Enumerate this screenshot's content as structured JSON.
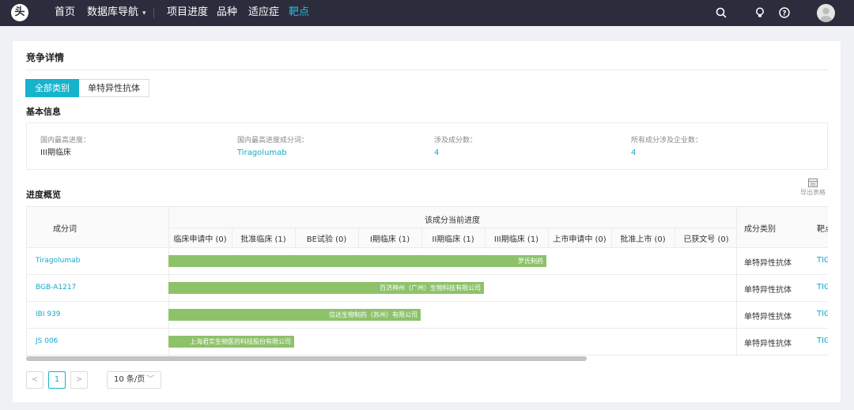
{
  "nav": {
    "logo_text": "头",
    "items": [
      "首页",
      "数据库导航",
      "项目进度",
      "品种",
      "适应症",
      "靶点"
    ],
    "dropdown_caret": "⌄"
  },
  "card": {
    "title": "竞争详情",
    "tabs": [
      "全部类别",
      "单特异性抗体"
    ],
    "basic_info_title": "基本信息",
    "info": [
      {
        "label": "国内最高进度：",
        "value": "III期临床"
      },
      {
        "label": "国内最高进度成分词：",
        "value": "Tiragolumab"
      },
      {
        "label": "涉及成分数：",
        "value": "4"
      },
      {
        "label": "所有成分涉及企业数：",
        "value": "4"
      }
    ],
    "progress_title": "进度概览",
    "export_label": "导出表格"
  },
  "table": {
    "col_component": "成分词",
    "col_progress": "该成分当前进度",
    "stages": [
      "临床申请中 (0)",
      "批准临床 (1)",
      "BE试验 (0)",
      "I期临床 (1)",
      "II期临床 (1)",
      "III期临床 (1)",
      "上市申请中 (0)",
      "批准上市 (0)",
      "已获文号 (0)"
    ],
    "col_category": "成分类别",
    "col_target": "靶点",
    "rows": [
      {
        "component": "Tiragolumab",
        "company": "罗氏制药",
        "progress": 0.6,
        "category": "单特异性抗体",
        "target": "TIGIT"
      },
      {
        "component": "BGB-A1217",
        "company": "百济神州（广州）生物科技有限公司",
        "progress": 0.5,
        "category": "单特异性抗体",
        "target": "TIGIT"
      },
      {
        "component": "IBI 939",
        "company": "信达生物制药（苏州）有限公司",
        "progress": 0.4,
        "category": "单特异性抗体",
        "target": "TIGIT"
      },
      {
        "component": "JS 006",
        "company": "上海君实生物医药科技股份有限公司",
        "progress": 0.2,
        "category": "单特异性抗体",
        "target": "TIGIT"
      }
    ]
  },
  "pager": {
    "prev": "<",
    "current": "1",
    "next": ">",
    "page_size": "10 条/页"
  }
}
